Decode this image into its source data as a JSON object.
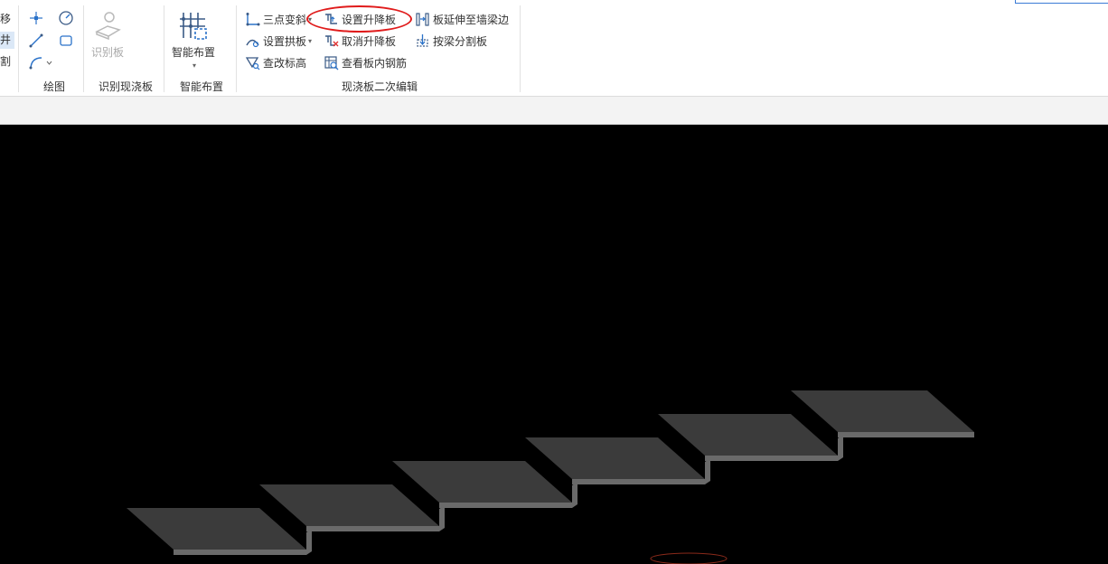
{
  "left_partial": {
    "items": [
      "移",
      "井",
      "割"
    ]
  },
  "draw_group": {
    "label": "绘图",
    "tools": [
      "point-icon",
      "circle-icon",
      "line-icon",
      "rectangle-icon",
      "arc-icon"
    ]
  },
  "recognize_group": {
    "label": "识别现浇板",
    "button_label": "识别板"
  },
  "smart_group": {
    "label": "智能布置",
    "button_label": "智能布置"
  },
  "edit_group": {
    "label": "现浇板二次编辑",
    "buttons": [
      {
        "label": "三点变斜",
        "icon": "three-point-slope-icon"
      },
      {
        "label": "设置升降板",
        "icon": "raise-lower-slab-icon"
      },
      {
        "label": "板延伸至墙梁边",
        "icon": "extend-slab-icon"
      },
      {
        "label": "设置拱板",
        "icon": "arch-slab-icon"
      },
      {
        "label": "取消升降板",
        "icon": "cancel-raise-lower-icon"
      },
      {
        "label": "按梁分割板",
        "icon": "split-by-beam-icon"
      },
      {
        "label": "查改标高",
        "icon": "elevation-icon"
      },
      {
        "label": "查看板内钢筋",
        "icon": "view-rebar-icon"
      }
    ]
  },
  "colors": {
    "highlight": "#e01b1b",
    "accent": "#3b7bd6",
    "slab_top": "#3b3b3b",
    "slab_side": "#6a6a6a",
    "viewport_bg": "#000000",
    "origin_marker": "#8a2a1a"
  },
  "scene": {
    "description_type": "stepped-slab-3d",
    "step_count": 6
  }
}
